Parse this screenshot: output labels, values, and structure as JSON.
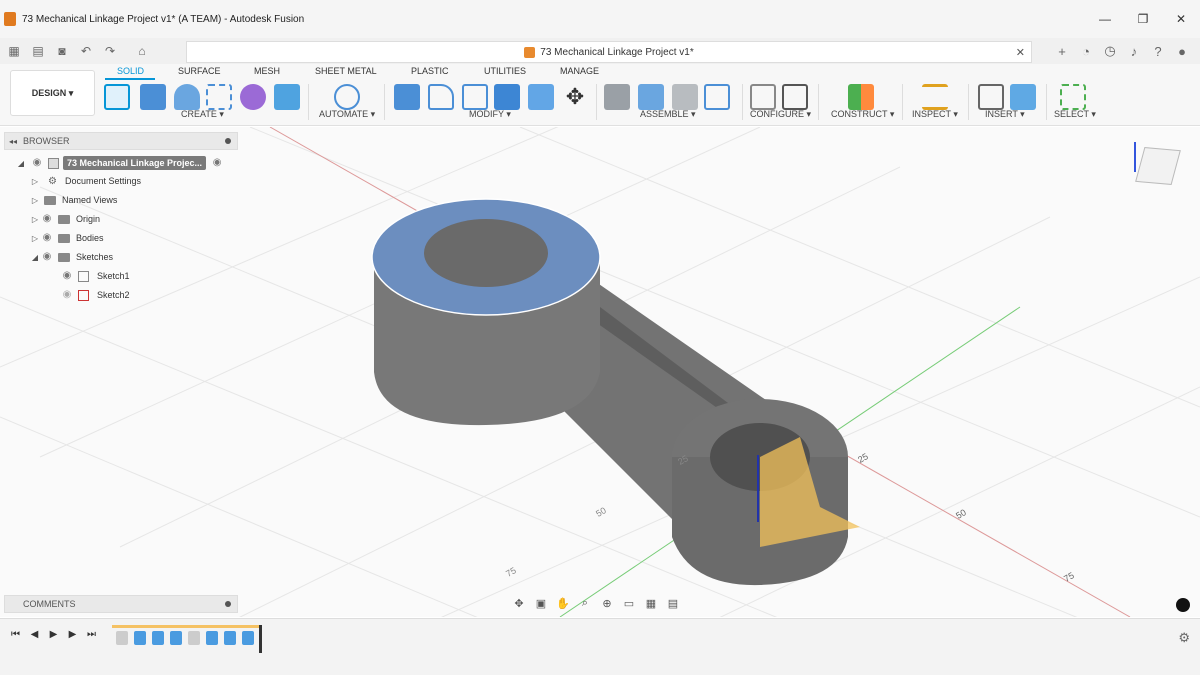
{
  "window": {
    "title": "73 Mechanical Linkage Project v1* (A TEAM) - Autodesk Fusion",
    "controls": [
      "—",
      "❐",
      "✕"
    ]
  },
  "document_tab": {
    "label": "73 Mechanical Linkage Project v1*"
  },
  "workspace": {
    "label": "DESIGN"
  },
  "ribbon": {
    "tabs": [
      "SOLID",
      "SURFACE",
      "MESH",
      "SHEET METAL",
      "PLASTIC",
      "UTILITIES",
      "MANAGE"
    ],
    "active_tab": "SOLID",
    "groups": [
      "CREATE ▾",
      "AUTOMATE ▾",
      "MODIFY ▾",
      "ASSEMBLE ▾",
      "CONFIGURE ▾",
      "CONSTRUCT ▾",
      "INSPECT ▾",
      "INSERT ▾",
      "SELECT ▾"
    ]
  },
  "browser": {
    "header": "BROWSER",
    "root": "73 Mechanical Linkage Projec...",
    "items": [
      "Document Settings",
      "Named Views",
      "Origin",
      "Bodies",
      "Sketches",
      "Sketch1",
      "Sketch2"
    ]
  },
  "comments": {
    "header": "COMMENTS"
  },
  "grid_labels": [
    "25",
    "50",
    "75",
    "25",
    "50",
    "75"
  ],
  "accent_color": "#0696d7",
  "face_color": "#6c8ebf",
  "body_color": "#707070"
}
